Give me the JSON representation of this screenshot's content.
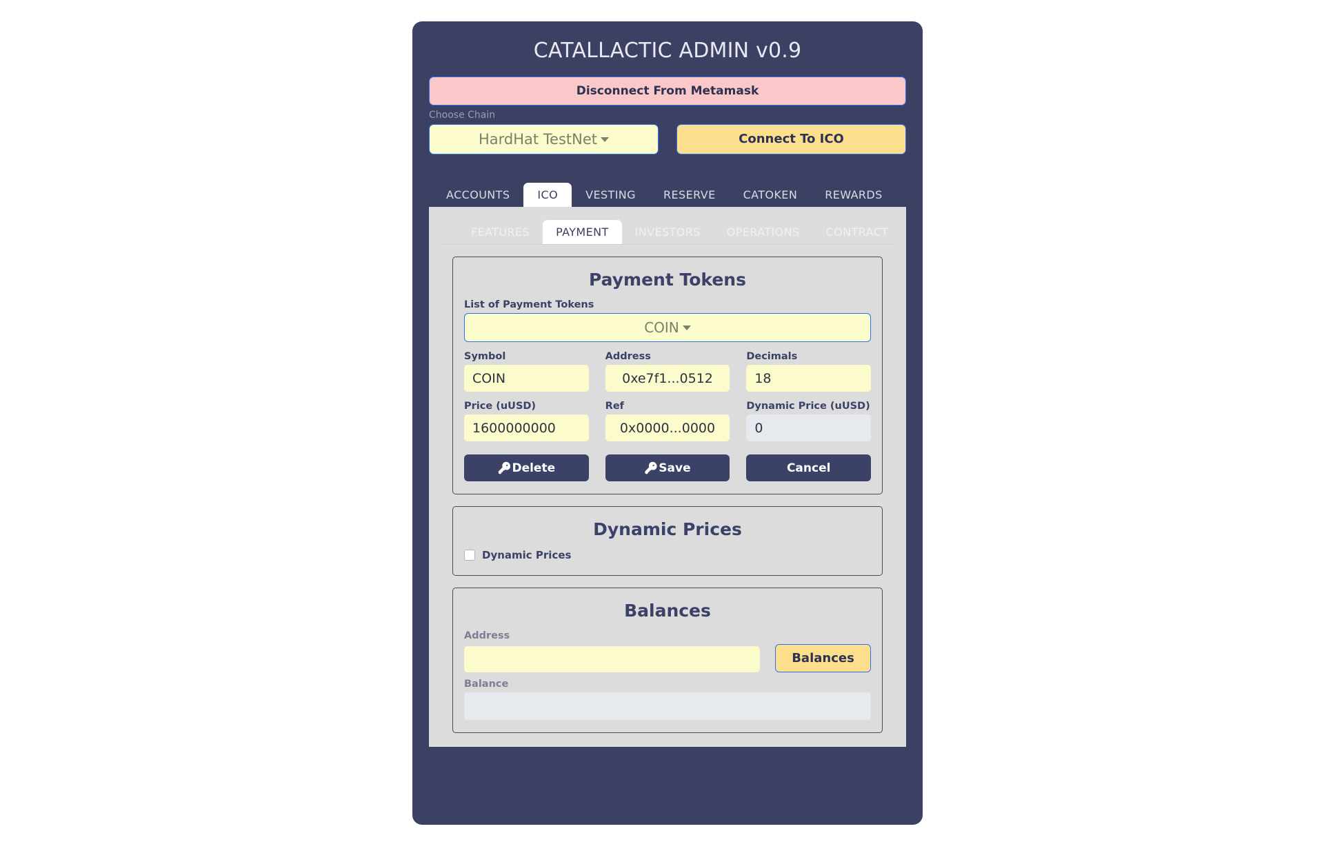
{
  "app": {
    "title": "CATALLACTIC ADMIN v0.9"
  },
  "wallet": {
    "disconnect_label": "Disconnect From Metamask",
    "chain_label": "Choose Chain",
    "chain_value": "HardHat TestNet",
    "connect_ico_label": "Connect To ICO"
  },
  "main_tabs": [
    {
      "label": "ACCOUNTS",
      "active": false
    },
    {
      "label": "ICO",
      "active": true
    },
    {
      "label": "VESTING",
      "active": false
    },
    {
      "label": "RESERVE",
      "active": false
    },
    {
      "label": "CATOKEN",
      "active": false
    },
    {
      "label": "REWARDS",
      "active": false
    }
  ],
  "sub_tabs": [
    {
      "label": "FEATURES",
      "active": false
    },
    {
      "label": "PAYMENT",
      "active": true
    },
    {
      "label": "INVESTORS",
      "active": false
    },
    {
      "label": "OPERATIONS",
      "active": false
    },
    {
      "label": "CONTRACT",
      "active": false
    }
  ],
  "payment_tokens": {
    "card_title": "Payment Tokens",
    "list_label": "List of Payment Tokens",
    "list_value": "COIN",
    "fields": {
      "symbol_label": "Symbol",
      "symbol_value": "COIN",
      "address_label": "Address",
      "address_value": "0xe7f1...0512",
      "decimals_label": "Decimals",
      "decimals_value": "18",
      "price_label": "Price (uUSD)",
      "price_value": "1600000000",
      "ref_label": "Ref",
      "ref_value": "0x0000...0000",
      "dynamic_price_label": "Dynamic Price (uUSD)",
      "dynamic_price_value": "0"
    },
    "buttons": {
      "delete_label": "Delete",
      "save_label": "Save",
      "cancel_label": "Cancel",
      "key_icon": "🔑"
    }
  },
  "dynamic_prices": {
    "card_title": "Dynamic Prices",
    "checkbox_label": "Dynamic Prices",
    "checked": false
  },
  "balances": {
    "card_title": "Balances",
    "address_label": "Address",
    "address_value": "",
    "button_label": "Balances",
    "balance_label": "Balance",
    "balance_value": ""
  },
  "colors": {
    "shell": "#3c4164",
    "panel": "#dddddd",
    "accent_yellow": "#fbdf8c",
    "input_yellow": "#fbfbcc",
    "danger_pink": "#fac8c8",
    "dark_button": "#3b4167",
    "border_blue": "#2f6fed"
  }
}
